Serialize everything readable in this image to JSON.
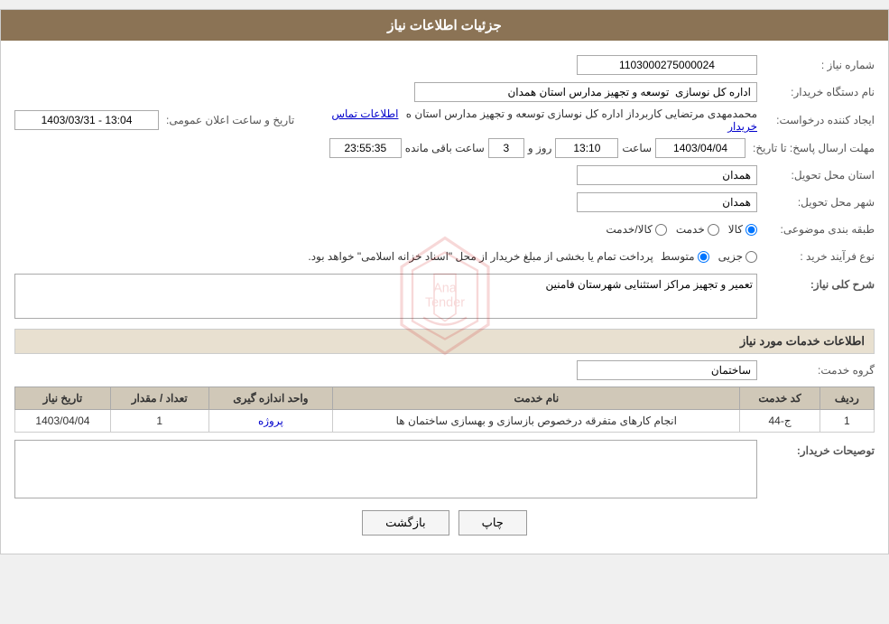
{
  "header": {
    "title": "جزئیات اطلاعات نیاز"
  },
  "fields": {
    "needle_number_label": "شماره نیاز :",
    "needle_number_value": "1103000275000024",
    "buyer_org_label": "نام دستگاه خریدار:",
    "buyer_org_value": "اداره کل نوسازی  توسعه و تجهیز مدارس استان همدان",
    "creator_label": "ایجاد کننده درخواست:",
    "creator_value": "محمدمهدی مرتضایی کاربرداز اداره کل نوسازی  توسعه و تجهیز مدارس استان ه",
    "creator_link": "اطلاعات تماس خریدار",
    "announce_label": "تاریخ و ساعت اعلان عمومی:",
    "announce_value": "1403/03/31 - 13:04",
    "deadline_label": "مهلت ارسال پاسخ: تا تاریخ:",
    "deadline_date": "1403/04/04",
    "deadline_time": "13:10",
    "deadline_days": "3",
    "deadline_remaining": "23:55:35",
    "deadline_days_label": "روز و",
    "deadline_time_label": "ساعت",
    "deadline_remaining_label": "ساعت باقی مانده",
    "province_label": "استان محل تحویل:",
    "province_value": "همدان",
    "city_label": "شهر محل تحویل:",
    "city_value": "همدان",
    "category_label": "طبقه بندی موضوعی:",
    "category_options": [
      "کالا",
      "خدمت",
      "کالا/خدمت"
    ],
    "category_selected": "کالا",
    "purchase_type_label": "نوع فرآیند خرید :",
    "purchase_type_options": [
      "جزیی",
      "متوسط"
    ],
    "purchase_type_selected": "متوسط",
    "purchase_note": "پرداخت تمام یا بخشی از مبلغ خریدار از محل \"اسناد خزانه اسلامی\" خواهد بود.",
    "description_label": "شرح کلی نیاز:",
    "description_value": "تعمیر و تجهیز مراکز استثنایی شهرستان فامنین",
    "services_section_title": "اطلاعات خدمات مورد نیاز",
    "service_group_label": "گروه خدمت:",
    "service_group_value": "ساختمان",
    "table": {
      "headers": [
        "ردیف",
        "کد خدمت",
        "نام خدمت",
        "واحد اندازه گیری",
        "تعداد / مقدار",
        "تاریخ نیاز"
      ],
      "rows": [
        {
          "row": "1",
          "code": "ج-44",
          "name": "انجام کارهای متفرقه درخصوص بازسازی و بهسازی ساختمان ها",
          "unit": "پروژه",
          "quantity": "1",
          "date": "1403/04/04"
        }
      ]
    },
    "buyer_notes_label": "توصیحات خریدار:",
    "buyer_notes_value": "",
    "btn_print": "چاپ",
    "btn_back": "بازگشت"
  }
}
